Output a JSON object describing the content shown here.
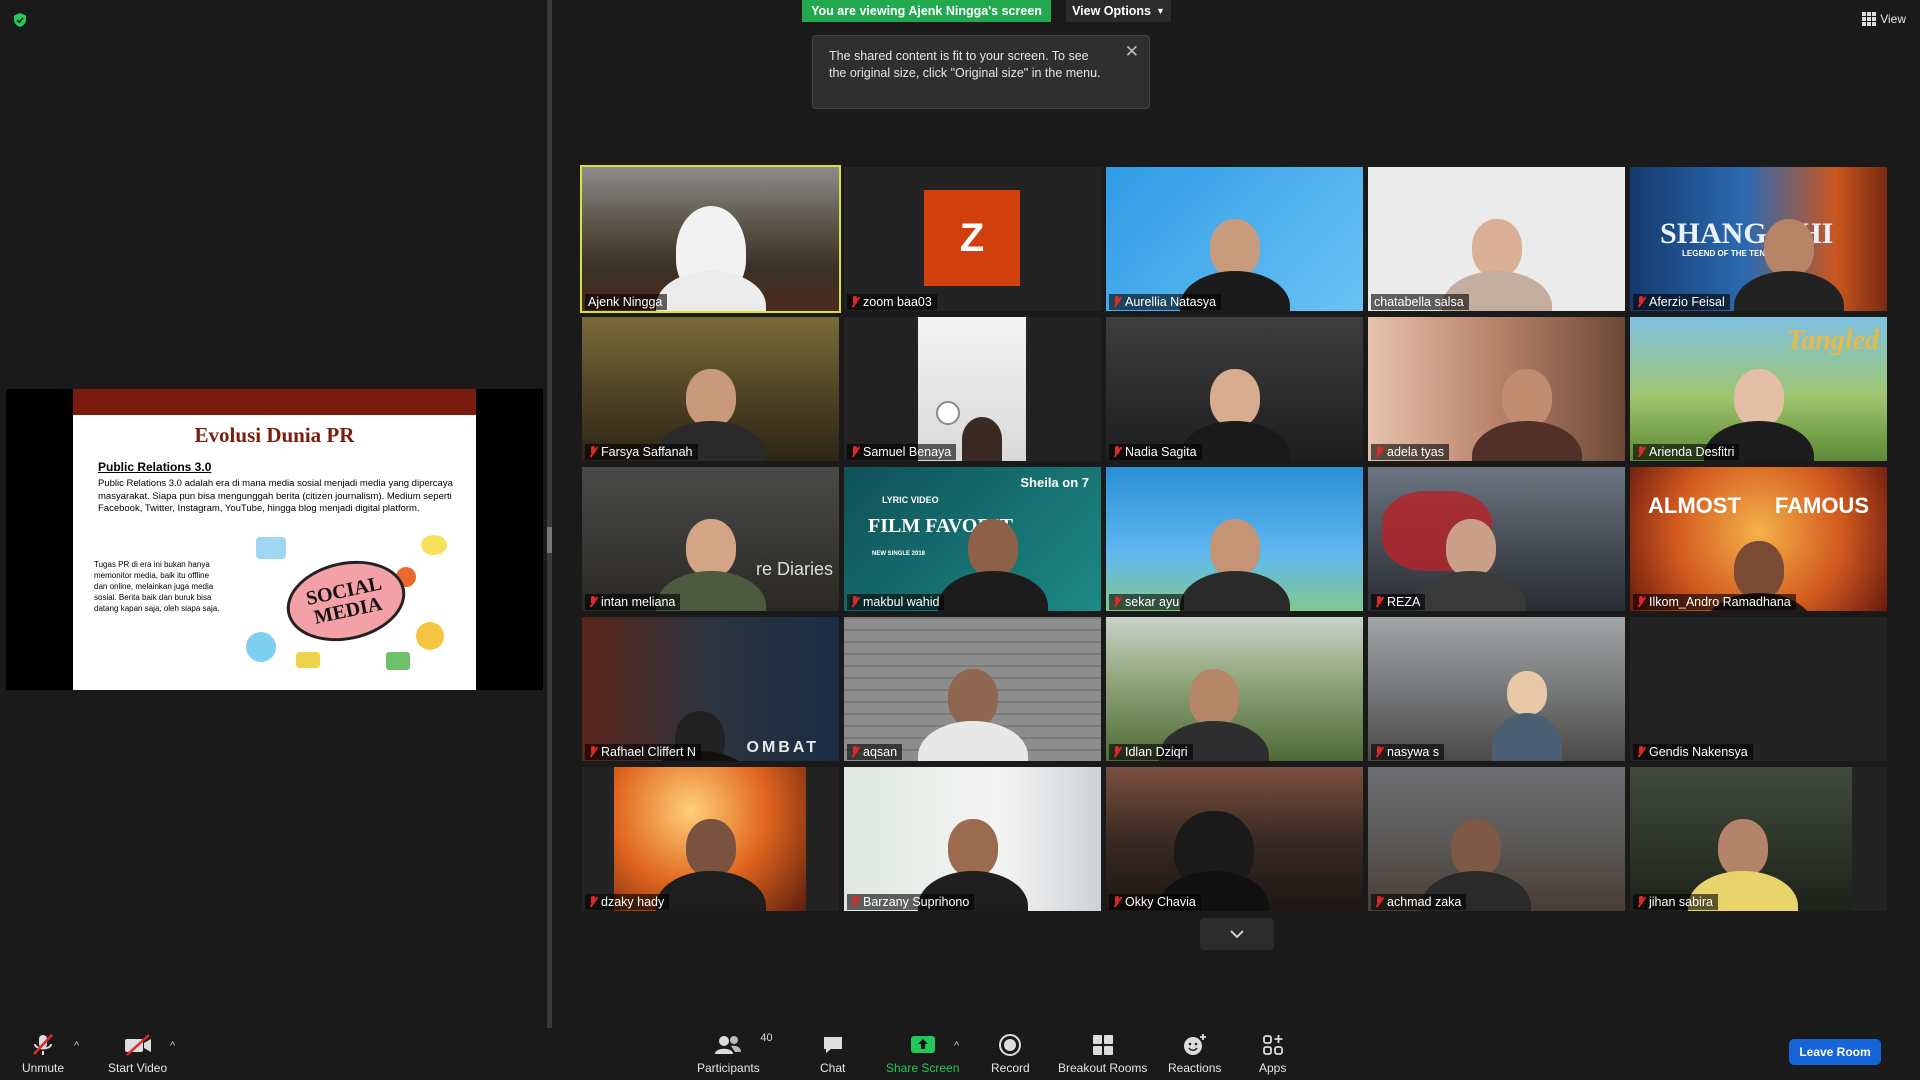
{
  "top": {
    "viewing_banner": "You are viewing Ajenk Ningga's screen",
    "view_options": "View Options",
    "view_button": "View",
    "tooltip_text": "The shared content is fit to your screen. To see the original size, click \"Original size\" in the menu."
  },
  "slide": {
    "title": "Evolusi Dunia PR",
    "subtitle": "Public Relations 3.0",
    "paragraph": "Public Relations 3.0 adalah era di mana media sosial menjadi media yang dipercaya masyarakat. Siapa pun bisa mengunggah berita (citizen journalism). Medium seperti Facebook, Twitter, Instagram, YouTube, hingga blog menjadi digital platform.",
    "side_text": "Tugas PR di era ini bukan hanya memonitor media, baik itu offline dan online, melainkan juga media sosial. Berita baik dan buruk bisa datang kapan saja, oleh siapa saja.",
    "art_text": "SOCIAL MEDIA",
    "accent": "#7a1d0e"
  },
  "participants_grid": [
    {
      "name": "Ajenk Ningga",
      "muted": false,
      "active": true
    },
    {
      "name": "zoom baa03",
      "muted": true,
      "avatar_letter": "Z"
    },
    {
      "name": "Aurellia Natasya",
      "muted": true
    },
    {
      "name": "chatabella salsa",
      "muted": false
    },
    {
      "name": "Aferzio Feisal",
      "muted": true
    },
    {
      "name": "Farsya Saffanah",
      "muted": true
    },
    {
      "name": "Samuel Benaya",
      "muted": true
    },
    {
      "name": "Nadia Sagita",
      "muted": true
    },
    {
      "name": "adela tyas",
      "muted": true
    },
    {
      "name": "Arienda Desfitri",
      "muted": true
    },
    {
      "name": "intan meliana",
      "muted": true
    },
    {
      "name": "makbul wahid",
      "muted": true
    },
    {
      "name": "sekar ayu",
      "muted": true
    },
    {
      "name": "REZA",
      "muted": true
    },
    {
      "name": "Ilkom_Andro Ramadhana",
      "muted": true
    },
    {
      "name": "Rafhael Cliffert N",
      "muted": true
    },
    {
      "name": "aqsan",
      "muted": true
    },
    {
      "name": "Idlan Dziqri",
      "muted": true
    },
    {
      "name": "nasywa s",
      "muted": true
    },
    {
      "name": "Gendis Nakensya",
      "muted": true
    },
    {
      "name": "dzaky hady",
      "muted": true
    },
    {
      "name": "Barzany Suprihono",
      "muted": true
    },
    {
      "name": "Okky Chavia",
      "muted": true
    },
    {
      "name": "achmad zaka",
      "muted": true
    },
    {
      "name": "jihan sabira",
      "muted": true
    }
  ],
  "posters": {
    "shangchi": "SHANG-CHI",
    "shangchi_sub": "LEGEND OF THE TEN RINGS",
    "tangled": "Tangled",
    "film_favorit": "FILM FAVORIT",
    "lyric_video": "LYRIC VIDEO",
    "new_single": "NEW SINGLE 2018",
    "sheila": "Sheila on 7",
    "almost": "ALMOST",
    "famous": "FAMOUS",
    "vampire": "re Diaries",
    "kombat": "OMBAT"
  },
  "toolbar": {
    "unmute": "Unmute",
    "start_video": "Start Video",
    "participants": "Participants",
    "participants_count": "40",
    "chat": "Chat",
    "share_screen": "Share Screen",
    "record": "Record",
    "breakout_rooms": "Breakout Rooms",
    "reactions": "Reactions",
    "apps": "Apps",
    "leave_room": "Leave Room"
  },
  "colors": {
    "banner_green": "#22a94f",
    "leave_blue": "#1565d8",
    "active_speaker": "#d6e23a",
    "mute_red": "#e02828"
  }
}
